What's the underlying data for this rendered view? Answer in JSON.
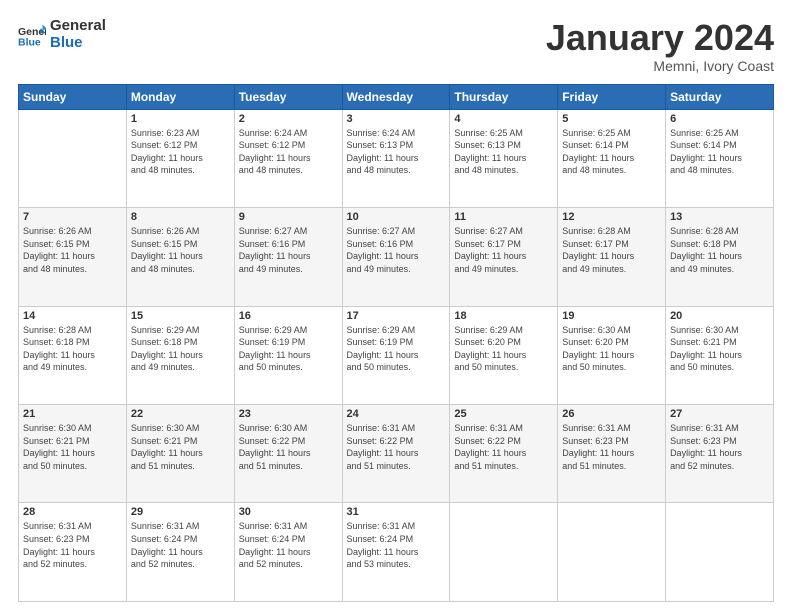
{
  "logo": {
    "line1": "General",
    "line2": "Blue"
  },
  "title": "January 2024",
  "location": "Memni, Ivory Coast",
  "days_header": [
    "Sunday",
    "Monday",
    "Tuesday",
    "Wednesday",
    "Thursday",
    "Friday",
    "Saturday"
  ],
  "weeks": [
    [
      {
        "day": "",
        "info": ""
      },
      {
        "day": "1",
        "info": "Sunrise: 6:23 AM\nSunset: 6:12 PM\nDaylight: 11 hours\nand 48 minutes."
      },
      {
        "day": "2",
        "info": "Sunrise: 6:24 AM\nSunset: 6:12 PM\nDaylight: 11 hours\nand 48 minutes."
      },
      {
        "day": "3",
        "info": "Sunrise: 6:24 AM\nSunset: 6:13 PM\nDaylight: 11 hours\nand 48 minutes."
      },
      {
        "day": "4",
        "info": "Sunrise: 6:25 AM\nSunset: 6:13 PM\nDaylight: 11 hours\nand 48 minutes."
      },
      {
        "day": "5",
        "info": "Sunrise: 6:25 AM\nSunset: 6:14 PM\nDaylight: 11 hours\nand 48 minutes."
      },
      {
        "day": "6",
        "info": "Sunrise: 6:25 AM\nSunset: 6:14 PM\nDaylight: 11 hours\nand 48 minutes."
      }
    ],
    [
      {
        "day": "7",
        "info": "Sunrise: 6:26 AM\nSunset: 6:15 PM\nDaylight: 11 hours\nand 48 minutes."
      },
      {
        "day": "8",
        "info": "Sunrise: 6:26 AM\nSunset: 6:15 PM\nDaylight: 11 hours\nand 48 minutes."
      },
      {
        "day": "9",
        "info": "Sunrise: 6:27 AM\nSunset: 6:16 PM\nDaylight: 11 hours\nand 49 minutes."
      },
      {
        "day": "10",
        "info": "Sunrise: 6:27 AM\nSunset: 6:16 PM\nDaylight: 11 hours\nand 49 minutes."
      },
      {
        "day": "11",
        "info": "Sunrise: 6:27 AM\nSunset: 6:17 PM\nDaylight: 11 hours\nand 49 minutes."
      },
      {
        "day": "12",
        "info": "Sunrise: 6:28 AM\nSunset: 6:17 PM\nDaylight: 11 hours\nand 49 minutes."
      },
      {
        "day": "13",
        "info": "Sunrise: 6:28 AM\nSunset: 6:18 PM\nDaylight: 11 hours\nand 49 minutes."
      }
    ],
    [
      {
        "day": "14",
        "info": "Sunrise: 6:28 AM\nSunset: 6:18 PM\nDaylight: 11 hours\nand 49 minutes."
      },
      {
        "day": "15",
        "info": "Sunrise: 6:29 AM\nSunset: 6:18 PM\nDaylight: 11 hours\nand 49 minutes."
      },
      {
        "day": "16",
        "info": "Sunrise: 6:29 AM\nSunset: 6:19 PM\nDaylight: 11 hours\nand 50 minutes."
      },
      {
        "day": "17",
        "info": "Sunrise: 6:29 AM\nSunset: 6:19 PM\nDaylight: 11 hours\nand 50 minutes."
      },
      {
        "day": "18",
        "info": "Sunrise: 6:29 AM\nSunset: 6:20 PM\nDaylight: 11 hours\nand 50 minutes."
      },
      {
        "day": "19",
        "info": "Sunrise: 6:30 AM\nSunset: 6:20 PM\nDaylight: 11 hours\nand 50 minutes."
      },
      {
        "day": "20",
        "info": "Sunrise: 6:30 AM\nSunset: 6:21 PM\nDaylight: 11 hours\nand 50 minutes."
      }
    ],
    [
      {
        "day": "21",
        "info": "Sunrise: 6:30 AM\nSunset: 6:21 PM\nDaylight: 11 hours\nand 50 minutes."
      },
      {
        "day": "22",
        "info": "Sunrise: 6:30 AM\nSunset: 6:21 PM\nDaylight: 11 hours\nand 51 minutes."
      },
      {
        "day": "23",
        "info": "Sunrise: 6:30 AM\nSunset: 6:22 PM\nDaylight: 11 hours\nand 51 minutes."
      },
      {
        "day": "24",
        "info": "Sunrise: 6:31 AM\nSunset: 6:22 PM\nDaylight: 11 hours\nand 51 minutes."
      },
      {
        "day": "25",
        "info": "Sunrise: 6:31 AM\nSunset: 6:22 PM\nDaylight: 11 hours\nand 51 minutes."
      },
      {
        "day": "26",
        "info": "Sunrise: 6:31 AM\nSunset: 6:23 PM\nDaylight: 11 hours\nand 51 minutes."
      },
      {
        "day": "27",
        "info": "Sunrise: 6:31 AM\nSunset: 6:23 PM\nDaylight: 11 hours\nand 52 minutes."
      }
    ],
    [
      {
        "day": "28",
        "info": "Sunrise: 6:31 AM\nSunset: 6:23 PM\nDaylight: 11 hours\nand 52 minutes."
      },
      {
        "day": "29",
        "info": "Sunrise: 6:31 AM\nSunset: 6:24 PM\nDaylight: 11 hours\nand 52 minutes."
      },
      {
        "day": "30",
        "info": "Sunrise: 6:31 AM\nSunset: 6:24 PM\nDaylight: 11 hours\nand 52 minutes."
      },
      {
        "day": "31",
        "info": "Sunrise: 6:31 AM\nSunset: 6:24 PM\nDaylight: 11 hours\nand 53 minutes."
      },
      {
        "day": "",
        "info": ""
      },
      {
        "day": "",
        "info": ""
      },
      {
        "day": "",
        "info": ""
      }
    ]
  ]
}
